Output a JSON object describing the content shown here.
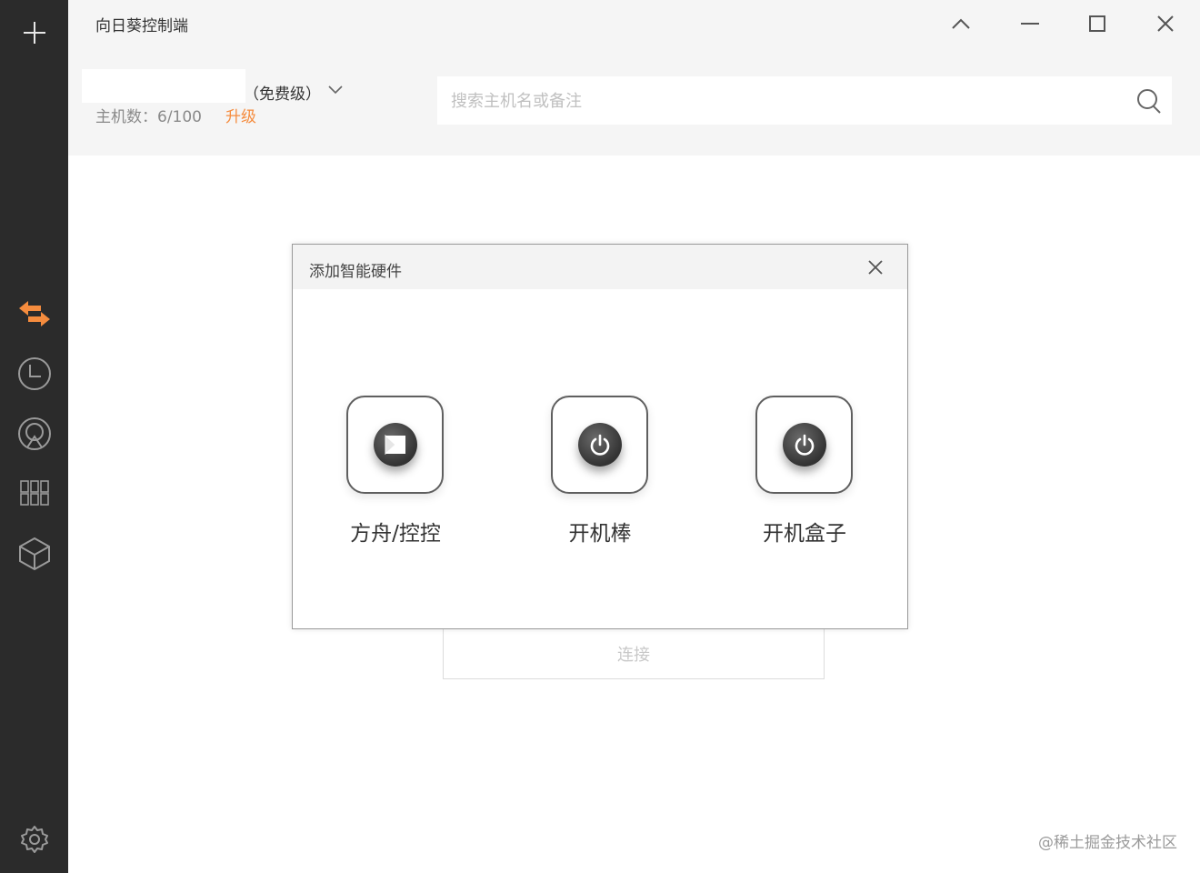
{
  "app": {
    "title": "向日葵控制端"
  },
  "account": {
    "plan": "（免费级）",
    "hosts_label": "主机数：6/100",
    "upgrade_label": "升级"
  },
  "search": {
    "placeholder": "搜索主机名或备注"
  },
  "main": {
    "connect_label": "连接"
  },
  "dialog": {
    "title": "添加智能硬件",
    "items": [
      {
        "label": "方舟/控控",
        "icon": "ark-play-icon"
      },
      {
        "label": "开机棒",
        "icon": "power-icon"
      },
      {
        "label": "开机盒子",
        "icon": "power-icon"
      }
    ]
  },
  "sidebar": {
    "items": [
      {
        "name": "add",
        "icon": "plus-icon"
      },
      {
        "name": "remote-control",
        "icon": "swap-arrows-icon",
        "active": true
      },
      {
        "name": "history",
        "icon": "clock-icon"
      },
      {
        "name": "discovery",
        "icon": "location-icon"
      },
      {
        "name": "apps",
        "icon": "grid-icon"
      },
      {
        "name": "hardware",
        "icon": "cube-icon"
      },
      {
        "name": "settings",
        "icon": "gear-icon"
      }
    ]
  },
  "colors": {
    "accent": "#f58c3e",
    "sidebar": "#2b2b2b",
    "topbar": "#f5f5f5"
  },
  "watermark": "@稀土掘金技术社区"
}
